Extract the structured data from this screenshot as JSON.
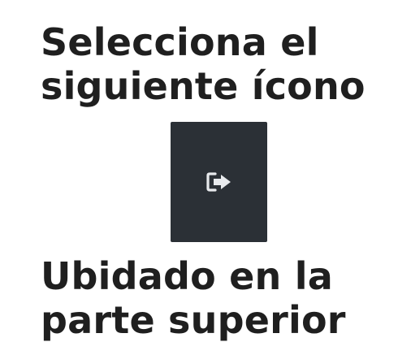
{
  "instruction_top": {
    "line1": "Selecciona el",
    "line2": "siguiente ícono"
  },
  "icon": {
    "name": "sign-out-icon",
    "background": "#2b3036",
    "color": "#e8eaed"
  },
  "instruction_bottom": {
    "line1": "Ubidado en la",
    "line2": "parte superior"
  }
}
